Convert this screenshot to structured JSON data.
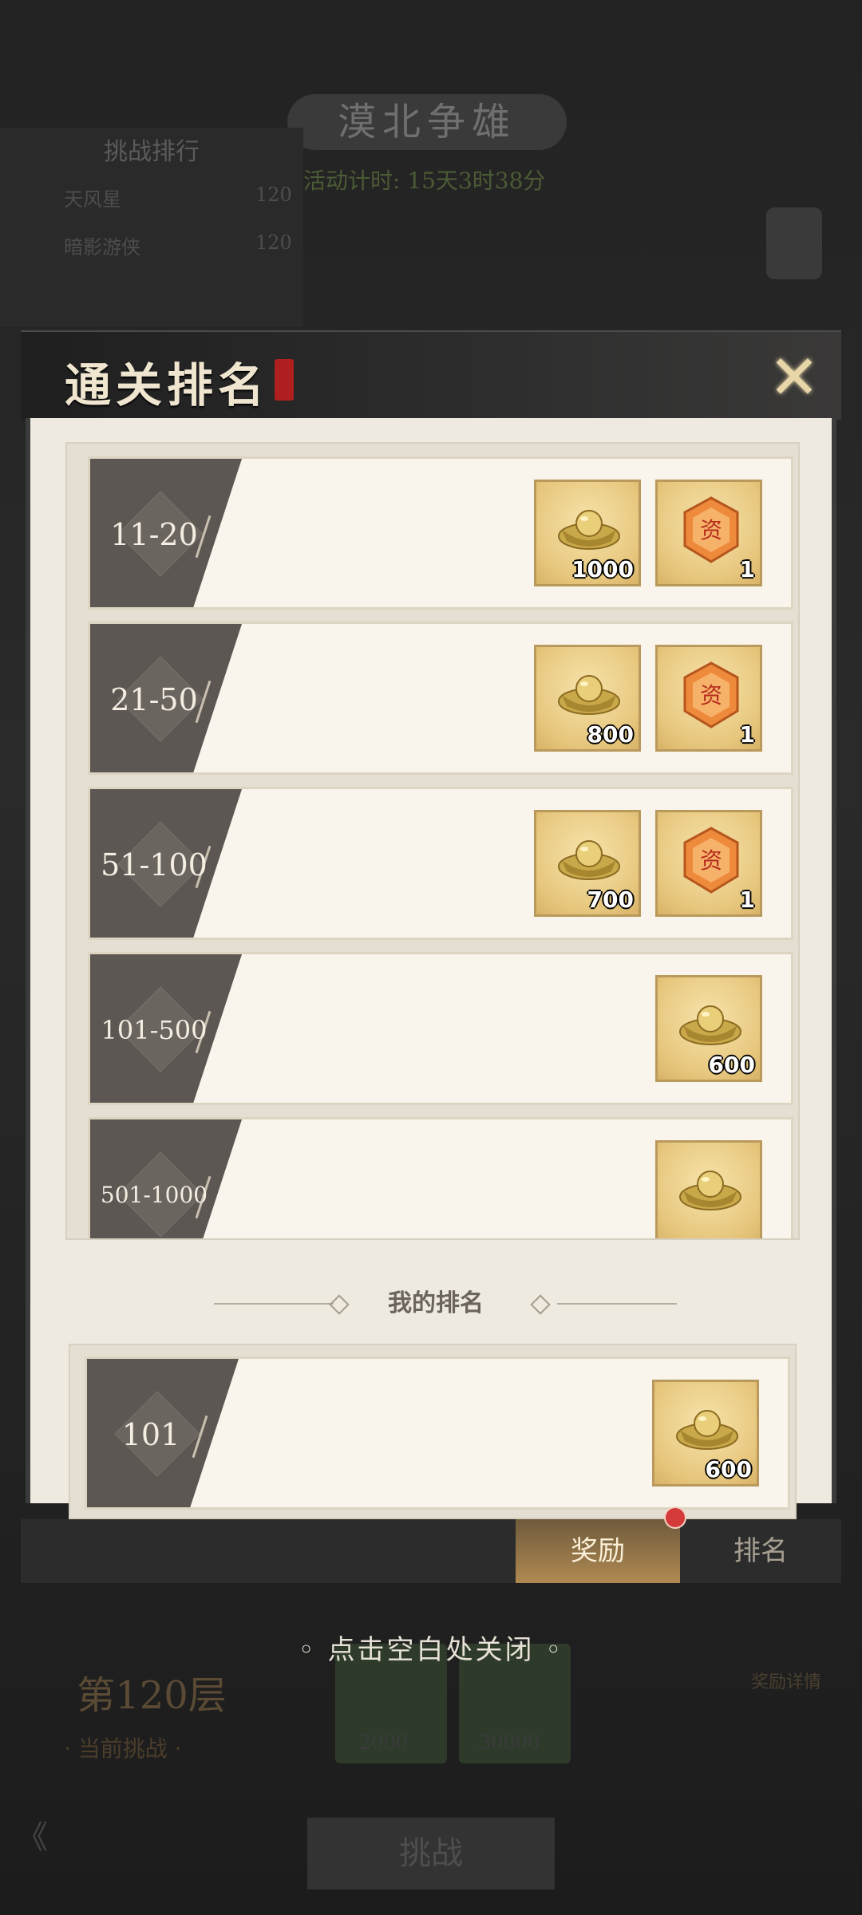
{
  "background": {
    "title": "漠北争雄",
    "panel_title": "挑战排行",
    "entries": [
      {
        "name": "天风星",
        "score": "120"
      },
      {
        "name": "暗影游侠",
        "score": "120"
      }
    ],
    "countdown": "活动计时: 15天3时38分",
    "floor": "第120层",
    "floor_sub": "· 当前挑战 ·",
    "check_values": [
      "2000",
      "30000"
    ],
    "challenge_label": "挑战",
    "reward_button": "奖励详情"
  },
  "dialog": {
    "title": "通关排名",
    "close_icon": "close-icon",
    "ranks": [
      {
        "label": "11-20",
        "rewards": [
          {
            "icon": "gold-ingot-icon",
            "count": "1000"
          },
          {
            "icon": "badge-icon",
            "count": "1"
          }
        ]
      },
      {
        "label": "21-50",
        "rewards": [
          {
            "icon": "gold-ingot-icon",
            "count": "800"
          },
          {
            "icon": "badge-icon",
            "count": "1"
          }
        ]
      },
      {
        "label": "51-100",
        "rewards": [
          {
            "icon": "gold-ingot-icon",
            "count": "700"
          },
          {
            "icon": "badge-icon",
            "count": "1"
          }
        ]
      },
      {
        "label": "101-500",
        "rewards": [
          {
            "icon": "gold-ingot-icon",
            "count": "600"
          }
        ]
      },
      {
        "label": "501-1000",
        "rewards": [
          {
            "icon": "gold-ingot-icon",
            "count": ""
          }
        ]
      }
    ],
    "my_rank_title": "我的排名",
    "my_rank": {
      "label": "101",
      "rewards": [
        {
          "icon": "gold-ingot-icon",
          "count": "600"
        }
      ]
    },
    "tabs": {
      "reward": "奖励",
      "rank": "排名"
    }
  },
  "close_hint": "点击空白处关闭",
  "colors": {
    "accent": "#b08a52",
    "tab_dark": "#5c5752",
    "notification": "#d43a3a"
  }
}
